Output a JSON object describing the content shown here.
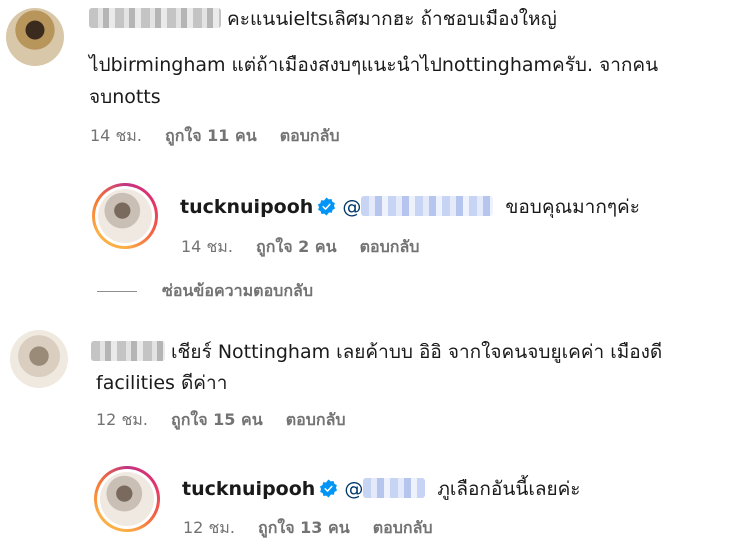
{
  "comments": [
    {
      "text_line1": "คะแนนieltsเลิศมากฮะ ถ้าชอบเมืองใหญ่",
      "text_line2": "ไปbirmingham แต่ถ้าเมืองสงบๆแนะนำไปnottinghamครับ. จากคน",
      "text_line3": "จบnotts",
      "time": "14 ชม.",
      "likes": "ถูกใจ 11 คน",
      "reply_label": "ตอบกลับ",
      "reply": {
        "username": "tucknuipooh",
        "mention": "@",
        "text": "ขอบคุณมากๆค่ะ",
        "time": "14 ชม.",
        "likes": "ถูกใจ 2 คน",
        "reply_label": "ตอบกลับ"
      },
      "hide_replies_label": "ซ่อนข้อความตอบกลับ"
    },
    {
      "text_line1": "เชียร์ Nottingham เลยค้าบบ อิอิ จากใจคนจบยูเคค่า เมืองดี",
      "text_line2": "facilities ดีค่าา",
      "time": "12 ชม.",
      "likes": "ถูกใจ 15 คน",
      "reply_label": "ตอบกลับ",
      "reply": {
        "username": "tucknuipooh",
        "mention": "@",
        "text": "ภูเลือกอันนี้เลยค่ะ",
        "time": "12 ชม.",
        "likes": "ถูกใจ 13 คน",
        "reply_label": "ตอบกลับ"
      }
    }
  ],
  "colors": {
    "text": "#1a1a1a",
    "meta": "#737373",
    "mention": "#00376b",
    "verified": "#0095f6"
  },
  "icons": {
    "verified": "verified-badge-icon"
  }
}
